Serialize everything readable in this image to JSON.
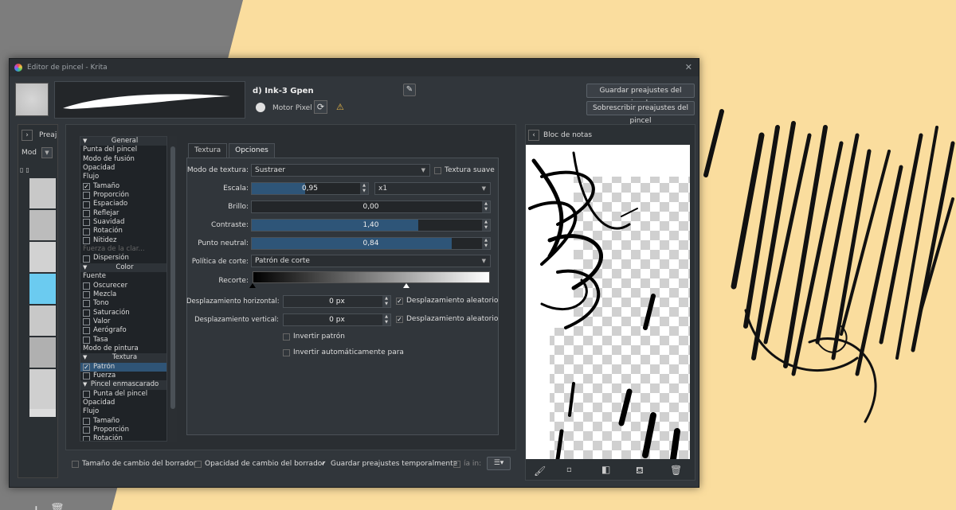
{
  "window": {
    "title": "Editor de pincel - Krita",
    "close": "✕"
  },
  "brush": {
    "name": "d) Ink-3 Gpen",
    "engine": "Motor Pixel"
  },
  "buttons": {
    "save": "Guardar preajustes del pincel...",
    "overwrite": "Sobrescribir preajustes del pincel"
  },
  "left": {
    "presets_label": "Preaj",
    "mode_label": "Mod"
  },
  "options_list": [
    {
      "t": "General",
      "sec": true
    },
    {
      "t": "Punta del pincel"
    },
    {
      "t": "Modo de fusión"
    },
    {
      "t": "Opacidad"
    },
    {
      "t": "Flujo"
    },
    {
      "t": "Tamaño",
      "cb": true,
      "checked": true
    },
    {
      "t": "Proporción",
      "cb": true
    },
    {
      "t": "Espaciado",
      "cb": true
    },
    {
      "t": "Reflejar",
      "cb": true
    },
    {
      "t": "Suavidad",
      "cb": true
    },
    {
      "t": "Rotación",
      "cb": true
    },
    {
      "t": "Nitidez",
      "cb": true
    },
    {
      "t": "Fuerza de la clar...",
      "dim": true
    },
    {
      "t": "Dispersión",
      "cb": true
    },
    {
      "t": "Color",
      "sec": true
    },
    {
      "t": "Fuente"
    },
    {
      "t": "Oscurecer",
      "cb": true
    },
    {
      "t": "Mezcla",
      "cb": true
    },
    {
      "t": "Tono",
      "cb": true
    },
    {
      "t": "Saturación",
      "cb": true
    },
    {
      "t": "Valor",
      "cb": true
    },
    {
      "t": "Aerógrafo",
      "cb": true
    },
    {
      "t": "Tasa",
      "cb": true
    },
    {
      "t": "Modo de pintura"
    },
    {
      "t": "Textura",
      "sec": true
    },
    {
      "t": "Patrón",
      "cb": true,
      "checked": true,
      "sel": true
    },
    {
      "t": "Fuerza",
      "cb": true
    },
    {
      "t": "Pincel enmascarado",
      "sec": true
    },
    {
      "t": "Punta del pincel",
      "cb": true
    },
    {
      "t": "Opacidad"
    },
    {
      "t": "Flujo"
    },
    {
      "t": "Tamaño",
      "cb": true
    },
    {
      "t": "Proporción",
      "cb": true
    },
    {
      "t": "Rotación",
      "cb": true
    }
  ],
  "tabs": {
    "texture": "Textura",
    "options": "Opciones"
  },
  "opts": {
    "texture_mode_label": "Modo de textura:",
    "texture_mode": "Sustraer",
    "soft_texture": "Textura suave",
    "scale_label": "Escala:",
    "scale": "0,95",
    "scale_mult": "x1",
    "brightness_label": "Brillo:",
    "brightness": "0,00",
    "contrast_label": "Contraste:",
    "contrast": "1,40",
    "neutral_label": "Punto neutral:",
    "neutral": "0,84",
    "cut_policy_label": "Política de corte:",
    "cut_policy": "Patrón de corte",
    "cutoff_label": "Recorte:",
    "hoff_label": "Desplazamiento horizontal:",
    "hoff": "0 px",
    "hrand": "Desplazamiento aleatorio",
    "voff_label": "Desplazamiento vertical:",
    "voff": "0 px",
    "vrand": "Desplazamiento aleatorio",
    "invert": "Invertir patrón",
    "auto_invert": "Invertir automáticamente para"
  },
  "slider_levels": {
    "scale": 0.46,
    "brightness": 0.0,
    "contrast": 0.7,
    "neutral": 0.84
  },
  "bottom": {
    "eraser_size": "Tamaño de cambio del borrador",
    "eraser_opacity": "Opacidad de cambio del borrador",
    "temp_save": "Guardar preajustes temporalmente",
    "clipped": "ía in:"
  },
  "notepad": {
    "title": "Bloc de notas"
  }
}
